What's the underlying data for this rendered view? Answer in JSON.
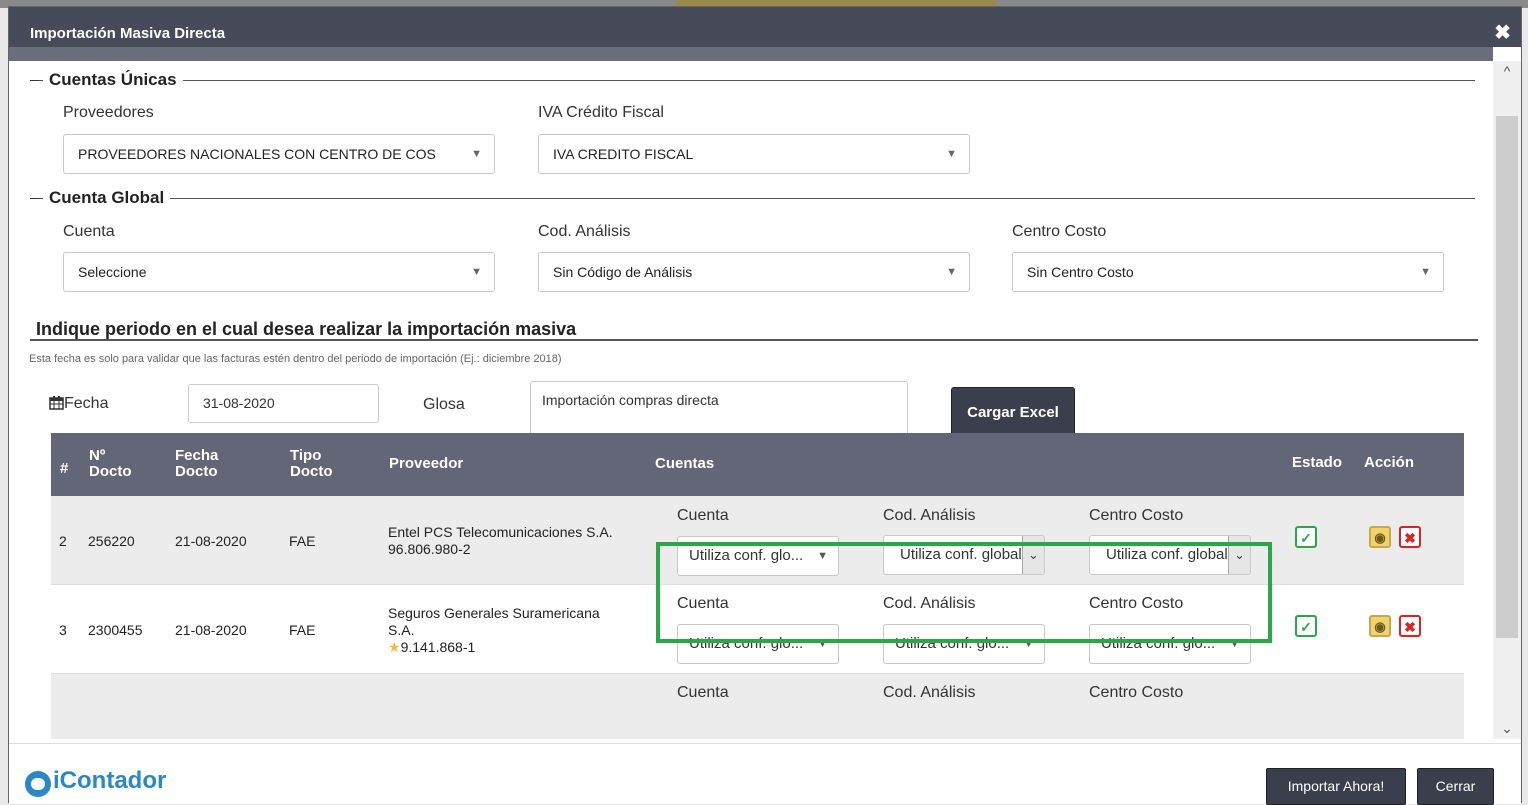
{
  "modal": {
    "title": "Importación Masiva Directa",
    "close_glyph": "✖"
  },
  "unique_accounts": {
    "legend": "Cuentas Únicas",
    "suppliers": {
      "label": "Proveedores",
      "value": "PROVEEDORES NACIONALES CON CENTRO DE COS"
    },
    "vat": {
      "label": "IVA Crédito Fiscal",
      "value": "IVA CREDITO FISCAL"
    }
  },
  "global_account": {
    "legend": "Cuenta Global",
    "account": {
      "label": "Cuenta",
      "value": "Seleccione"
    },
    "analysis": {
      "label": "Cod. Análisis",
      "value": "Sin Código de Análisis"
    },
    "cost_center": {
      "label": "Centro Costo",
      "value": "Sin Centro Costo"
    }
  },
  "period": {
    "heading": "Indique periodo en el cual desea realizar la importación masiva",
    "hint": "Esta fecha es solo para validar que las facturas estén dentro del periodo de importación (Ej.: diciembre 2018)",
    "date_label": "Fecha",
    "date_value": "31-08-2020",
    "gloss_label": "Glosa",
    "gloss_value": "Importación compras directa",
    "load_button": "Cargar Excel"
  },
  "table": {
    "headers": {
      "num": "#",
      "doc_no_1": "Nº",
      "doc_no_2": "Docto",
      "date_1": "Fecha",
      "date_2": "Docto",
      "type_1": "Tipo",
      "type_2": "Docto",
      "supplier": "Proveedor",
      "accounts": "Cuentas",
      "status": "Estado",
      "action": "Acción"
    },
    "sub_labels": {
      "account": "Cuenta",
      "analysis": "Cod. Análisis",
      "cost_center": "Centro Costo"
    },
    "rows": [
      {
        "num": "2",
        "doc_no": "256220",
        "date": "21-08-2020",
        "type": "FAE",
        "supplier_name": "Entel PCS Telecomunicaciones S.A.",
        "supplier_rut": "96.806.980-2",
        "account": "Utiliza conf. glo...",
        "analysis": "Utiliza conf. global",
        "cost_center": "Utiliza conf. global"
      },
      {
        "num": "3",
        "doc_no": "2300455",
        "date": "21-08-2020",
        "type": "FAE",
        "supplier_name_1": "Seguros Generales Suramericana",
        "supplier_name_2": "S.A.",
        "supplier_rut": "9.141.868-1",
        "account": "Utiliza conf. glo...",
        "analysis": "Utiliza conf. glo...",
        "cost_center": "Utiliza conf. glo..."
      }
    ],
    "partial_row": {
      "account": "Cuenta",
      "analysis": "Cod. Análisis",
      "cost_center": "Centro Costo"
    }
  },
  "footer": {
    "brand": "iContador",
    "import_button": "Importar Ahora!",
    "close_button": "Cerrar"
  },
  "colors": {
    "header": "#474b59",
    "table_header": "#636677",
    "highlight": "#2aa845",
    "brand": "#2a88c9"
  }
}
